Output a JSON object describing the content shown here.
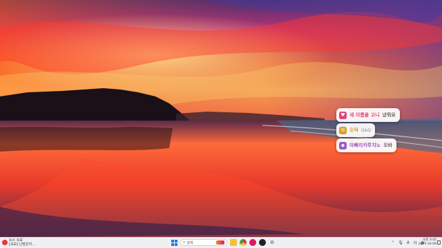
{
  "chips": [
    {
      "icon": "heart-icon",
      "accent": "새 이름을 고니",
      "rest": "냈뭐요",
      "accent_color": "#e0457b"
    },
    {
      "icon": "mail-icon",
      "accent": "오락",
      "muted": "Q&Q",
      "accent_color": "#d4a12a"
    },
    {
      "icon": "gift-icon",
      "accent": "아빠리카투치노",
      "rest": "오바",
      "accent_color": "#9b59c9"
    }
  ],
  "taskbar": {
    "weather_line1": "뉴스 속보",
    "weather_line2": "[속보] 난방은지...",
    "search_placeholder": "검색",
    "lang": "A",
    "ime": "가",
    "time": "오후 3:42",
    "date": "2025-10-09"
  },
  "colors": {
    "taskbar_bg": "#eef0f4"
  }
}
